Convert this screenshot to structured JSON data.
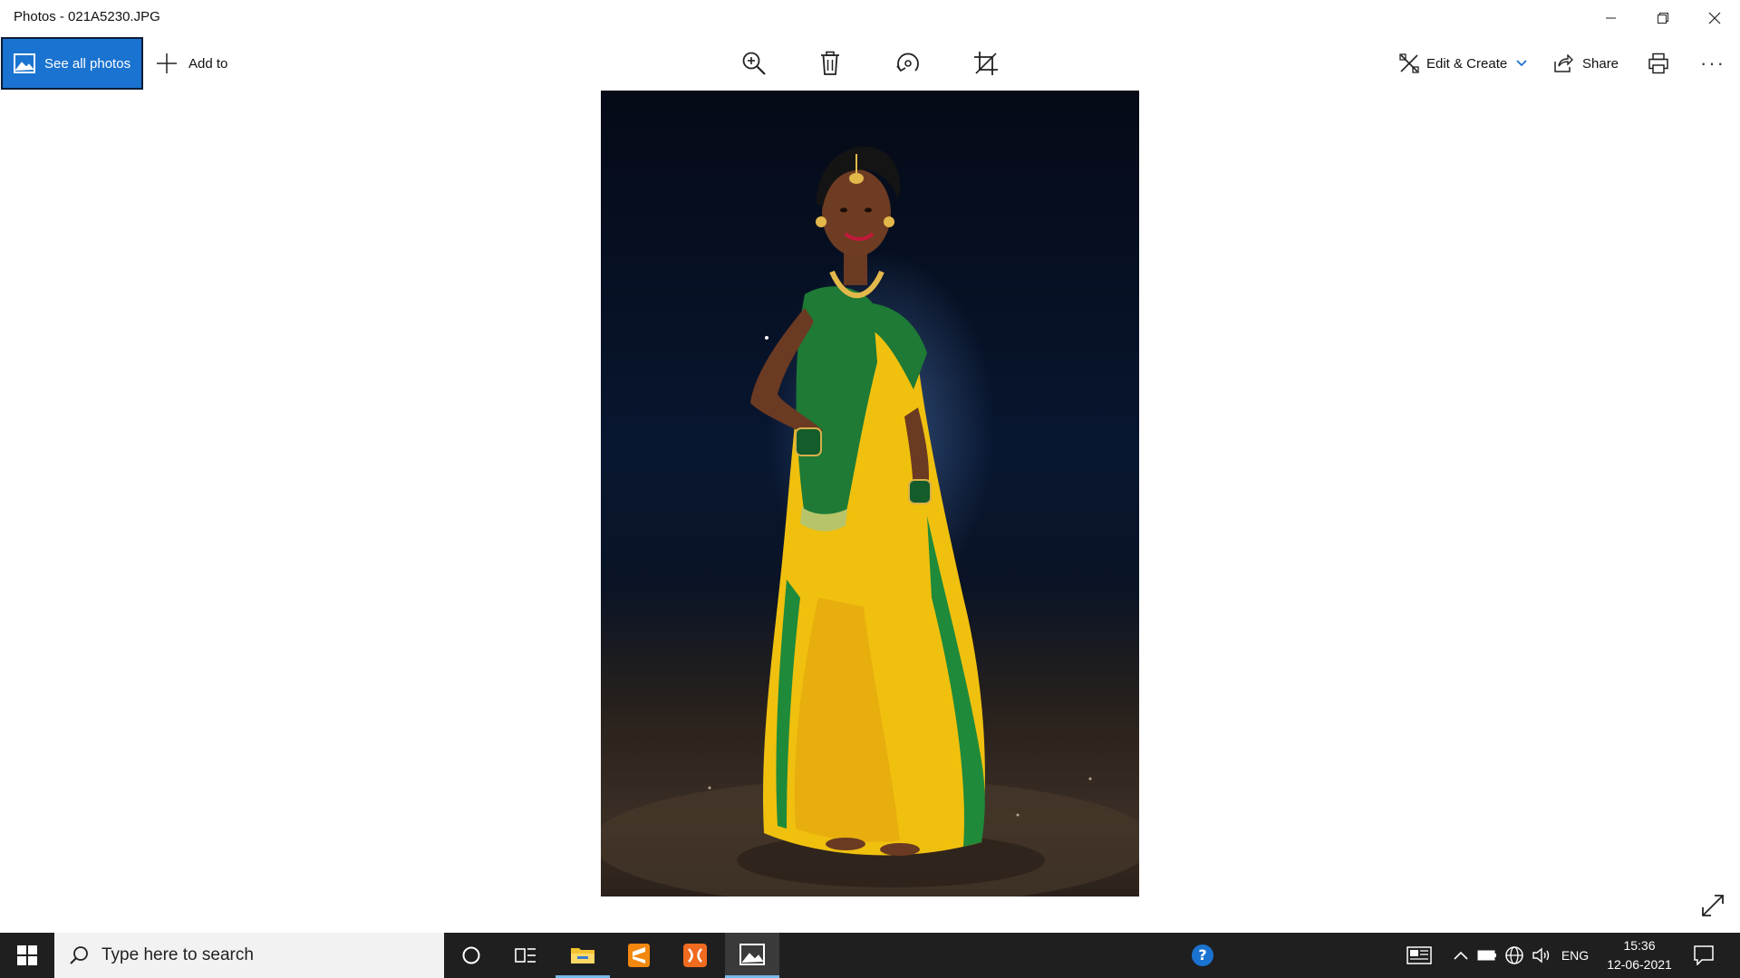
{
  "window": {
    "title": "Photos - 021A5230.JPG"
  },
  "toolbar": {
    "see_all_photos": "See all photos",
    "add_to": "Add to",
    "edit_create": "Edit & Create",
    "share": "Share",
    "more": "···"
  },
  "icons": {
    "zoom": "zoom-in-icon",
    "delete": "delete-icon",
    "rotate": "rotate-icon",
    "crop": "crop-icon",
    "print": "print-icon",
    "expand": "expand-icon"
  },
  "taskbar": {
    "search_placeholder": "Type here to search",
    "language": "ENG",
    "time": "15:36",
    "date": "12-06-2021"
  },
  "colors": {
    "accent": "#1a73d0",
    "taskbar": "#1f1f1f",
    "saree_yellow": "#f2c413",
    "saree_green": "#1f8a3a"
  }
}
